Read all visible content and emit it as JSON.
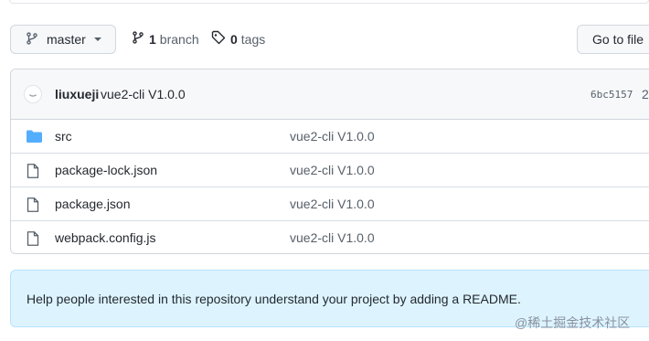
{
  "branch_selector": {
    "label": "master",
    "icon": "git-branch-icon"
  },
  "branches_link": {
    "count": "1",
    "label": "branch",
    "icon": "git-branch-icon"
  },
  "tags_link": {
    "count": "0",
    "label": "tags",
    "icon": "tag-icon"
  },
  "goto_file_button": {
    "label": "Go to file"
  },
  "latest_commit": {
    "author": "liuxueji",
    "message": "vue2-cli V1.0.0",
    "sha": "6bc5157",
    "time": "2"
  },
  "files": [
    {
      "type": "dir",
      "icon": "folder-icon",
      "name": "src",
      "commit_message": "vue2-cli V1.0.0"
    },
    {
      "type": "file",
      "icon": "file-icon",
      "name": "package-lock.json",
      "commit_message": "vue2-cli V1.0.0"
    },
    {
      "type": "file",
      "icon": "file-icon",
      "name": "package.json",
      "commit_message": "vue2-cli V1.0.0"
    },
    {
      "type": "file",
      "icon": "file-icon",
      "name": "webpack.config.js",
      "commit_message": "vue2-cli V1.0.0"
    }
  ],
  "readme_notice": {
    "text": "Help people interested in this repository understand your project by adding a README."
  },
  "watermark": {
    "text": "@稀土掘金技术社区"
  },
  "colors": {
    "folder": "#54aeff",
    "notice_bg": "#ddf4ff",
    "notice_border": "#b6e3ff"
  }
}
